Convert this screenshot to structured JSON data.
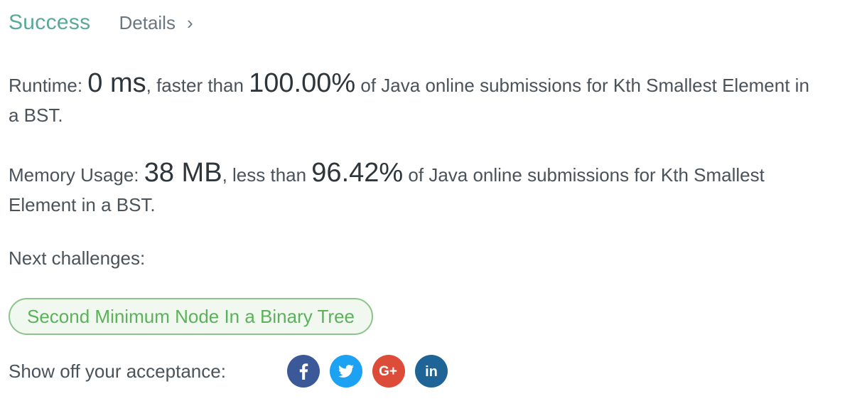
{
  "header": {
    "status": "Success",
    "details_label": "Details",
    "chevron": "›"
  },
  "runtime": {
    "label": "Runtime: ",
    "value": "0 ms",
    "comparison": ", faster than ",
    "percent": "100.00%",
    "suffix": " of Java online submissions for Kth Smallest Element in a BST."
  },
  "memory": {
    "label": "Memory Usage: ",
    "value": "38 MB",
    "comparison": ", less than ",
    "percent": "96.42%",
    "suffix": " of Java online submissions for Kth Smallest Element in a BST."
  },
  "next": {
    "label": "Next challenges:",
    "challenges": [
      "Second Minimum Node In a Binary Tree"
    ]
  },
  "share": {
    "label": "Show off your acceptance:",
    "networks": [
      {
        "name": "facebook-icon",
        "color": "#3b5998",
        "glyph": "f"
      },
      {
        "name": "twitter-icon",
        "color": "#1da1f2",
        "glyph": "bird"
      },
      {
        "name": "google-plus-icon",
        "color": "#dd4b39",
        "glyph": "G+"
      },
      {
        "name": "linkedin-icon",
        "color": "#1f6496",
        "glyph": "in"
      }
    ]
  }
}
